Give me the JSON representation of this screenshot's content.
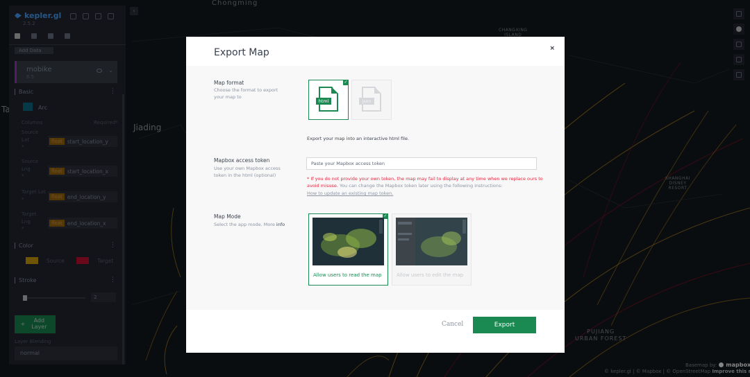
{
  "app": {
    "name": "kepler.gl",
    "version": "2.5.2"
  },
  "sidebar": {
    "add_data": "Add Data",
    "layer": {
      "name": "mobike",
      "sub": "8.5"
    },
    "sections": {
      "basic": "Basic",
      "color": "Color",
      "stroke": "Stroke"
    },
    "layer_type": "Arc",
    "columns_label": "Columns",
    "required_label": "Required*",
    "fields": [
      {
        "label": [
          "Source",
          "Lat",
          "*"
        ],
        "type": "float",
        "value": "start_location_y"
      },
      {
        "label": [
          "Source",
          "Lng",
          "*"
        ],
        "type": "float",
        "value": "start_location_x"
      },
      {
        "label": [
          "Target Lat",
          "*"
        ],
        "type": "float",
        "value": "end_location_y"
      },
      {
        "label": [
          "Target",
          "Lng",
          "*"
        ],
        "type": "float",
        "value": "end_location_x"
      }
    ],
    "color_source_label": "Source",
    "color_target_label": "Target",
    "source_color": "#d6a300",
    "target_color": "#c8102e",
    "stroke_value": "2",
    "add_layer_plus": "+",
    "add_layer": "Add Layer",
    "blending_label": "Layer Blending",
    "blending_value": "normal"
  },
  "map_labels": {
    "chongming": "Chongming",
    "jiading": "Jiading",
    "ta": "Ta",
    "changxing": [
      "CHANGXING",
      "ISLAND"
    ],
    "disney": [
      "SHANGHAI",
      "DISNEY",
      "RESORT"
    ],
    "pujiang": [
      "PUJIANG",
      "URBAN FOREST"
    ]
  },
  "modal": {
    "title": "Export Map",
    "close": "×",
    "format": {
      "title": "Map format",
      "desc": "Choose the format to export your map to",
      "options": [
        {
          "label": "html",
          "selected": true
        },
        {
          "label": "json",
          "selected": false
        }
      ],
      "check": "✓",
      "note": "Export your map into an interactive html file."
    },
    "token": {
      "title": "Mapbox access token",
      "desc": "Use your own Mapbox access token in the html (optional)",
      "placeholder": "Paste your Mapbox access token",
      "warning_red": "* If you do not provide your own token, the map may fail to display at any time when we replace ours to avoid misuse.",
      "warning_rest": " You can change the Mapbox token later using the following instructions:",
      "link": "How to update an existing map token."
    },
    "mode": {
      "title": "Map Mode",
      "desc": "Select the app mode. More",
      "desc_info": "info",
      "options": [
        {
          "label": "Allow users to read the map",
          "selected": true
        },
        {
          "label": "Allow users to edit the map",
          "selected": false
        }
      ]
    },
    "cancel": "Cancel",
    "export": "Export"
  },
  "attribution": {
    "basemap_by": "Basemap by:",
    "mapbox": "mapbox",
    "text": "© kepler.gl | © Mapbox | © OpenStreetMap",
    "improve": "Improve this map"
  },
  "colors": {
    "accent": "#1a8a52",
    "warning": "#e1293e",
    "layer_bar": "#9e3bbf"
  }
}
